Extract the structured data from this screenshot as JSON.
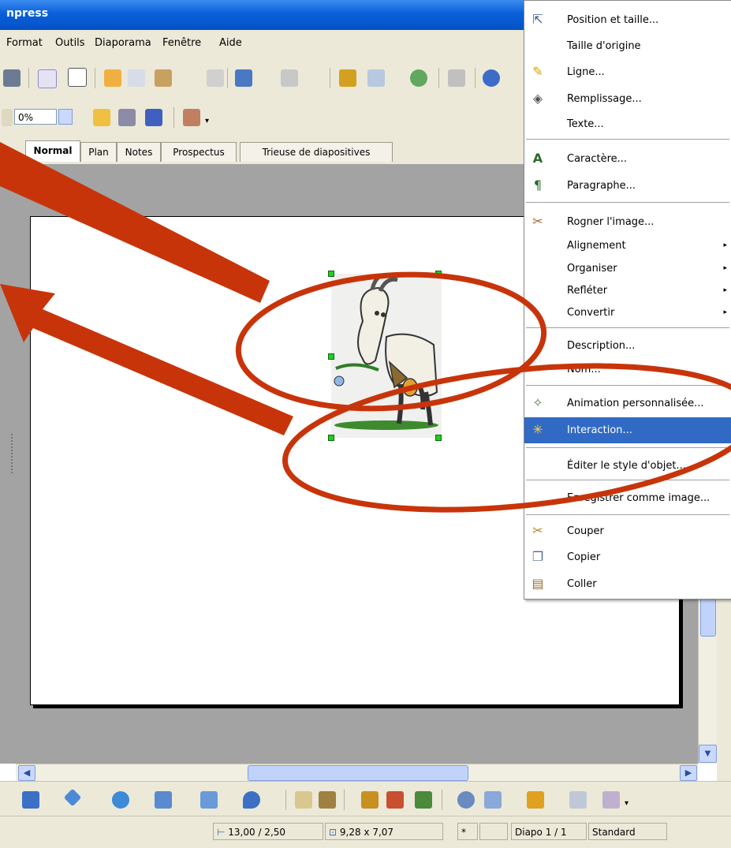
{
  "window": {
    "title": "npress"
  },
  "menubar": {
    "items": [
      "Format",
      "Outils",
      "Diaporama",
      "Fenêtre",
      "Aide"
    ]
  },
  "toolbar2": {
    "transparency_value": "0%"
  },
  "tabs": [
    "Normal",
    "Plan",
    "Notes",
    "Prospectus",
    "Trieuse de diapositives"
  ],
  "statusbar": {
    "position": "13,00 / 2,50",
    "size": "9,28 x 7,07",
    "modified": "*",
    "slide": "Diapo 1 / 1",
    "layout": "Standard"
  },
  "context_menu": {
    "items": [
      {
        "label": "Position et taille...",
        "icon": "position-size-icon"
      },
      {
        "label": "Taille d'origine",
        "icon": ""
      },
      {
        "label": "Ligne...",
        "icon": "line-icon"
      },
      {
        "label": "Remplissage...",
        "icon": "fill-icon"
      },
      {
        "label": "Texte...",
        "icon": ""
      },
      {
        "label": "Caractère...",
        "icon": "character-icon"
      },
      {
        "label": "Paragraphe...",
        "icon": "paragraph-icon"
      },
      {
        "label": "Rogner l'image...",
        "icon": "crop-icon"
      },
      {
        "label": "Alignement",
        "icon": "",
        "submenu": true
      },
      {
        "label": "Organiser",
        "icon": "",
        "submenu": true
      },
      {
        "label": "Refléter",
        "icon": "",
        "submenu": true
      },
      {
        "label": "Convertir",
        "icon": "",
        "submenu": true
      },
      {
        "label": "Description...",
        "icon": ""
      },
      {
        "label": "Nom...",
        "icon": ""
      },
      {
        "label": "Animation personnalisée...",
        "icon": "custom-animation-icon"
      },
      {
        "label": "Interaction...",
        "icon": "interaction-icon",
        "highlighted": true
      },
      {
        "label": "Éditer le style d'objet...",
        "icon": ""
      },
      {
        "label": "Enregistrer comme image...",
        "icon": ""
      },
      {
        "label": "Couper",
        "icon": "cut-icon"
      },
      {
        "label": "Copier",
        "icon": "copy-icon"
      },
      {
        "label": "Coller",
        "icon": "paste-icon"
      }
    ]
  },
  "colors": {
    "annotation": "#c8340a",
    "highlight": "#316ac5",
    "titlebar": "#0a5fd8",
    "selection_handle": "#22cc22"
  }
}
